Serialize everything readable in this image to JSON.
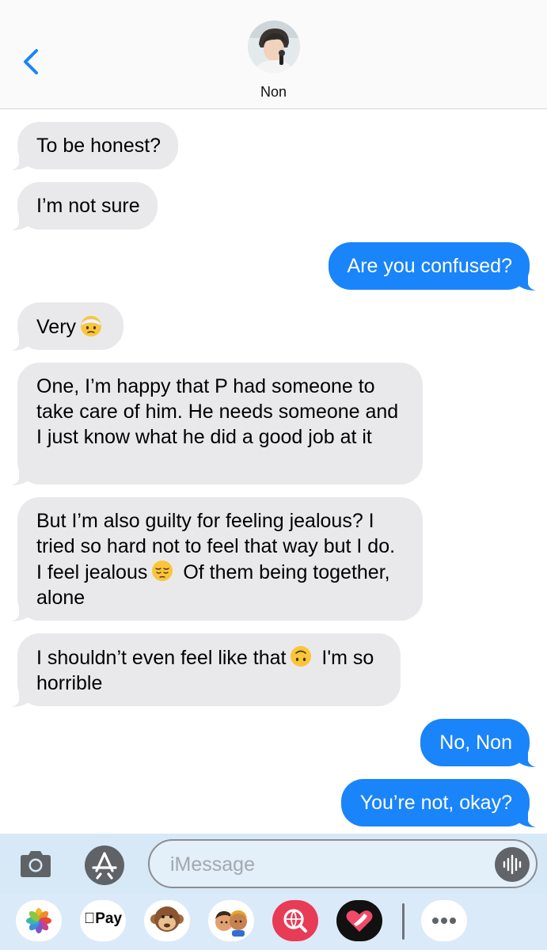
{
  "header": {
    "contact_name": "Non"
  },
  "messages": [
    {
      "side": "in",
      "text": "To be honest?"
    },
    {
      "side": "in",
      "text": "I’m not sure"
    },
    {
      "side": "out",
      "text": "Are you confused?"
    },
    {
      "side": "in",
      "text": "Very",
      "emoji": "head-bandage-emoji"
    },
    {
      "side": "in",
      "text": "One, I’m happy that P had someone to take care of him. He needs someone and I just know what he did a good job at it"
    },
    {
      "side": "in",
      "text_before": "But I’m also guilty for feeling jealous? I tried so hard not to feel that way but I do. I feel jealous",
      "emoji": "pensive-face-emoji",
      "text_after": "Of them being together, alone"
    },
    {
      "side": "in",
      "text_before": "I shouldn’t even feel like that",
      "emoji": "upside-down-face-emoji",
      "text_after": "I'm so horrible"
    },
    {
      "side": "out",
      "text": "No, Non"
    },
    {
      "side": "out",
      "text": "You’re not, okay?"
    }
  ],
  "input_bar": {
    "placeholder": "iMessage",
    "value": ""
  },
  "app_drawer": {
    "items": [
      {
        "icon": "photos-app-icon"
      },
      {
        "icon": "apple-pay-icon",
        "label": "Pay"
      },
      {
        "icon": "animoji-monkey-icon"
      },
      {
        "icon": "memoji-stickers-icon"
      },
      {
        "icon": "web-search-icon"
      },
      {
        "icon": "digital-touch-icon"
      },
      {
        "icon": "more-apps-icon"
      }
    ]
  },
  "colors": {
    "outgoing_bubble": "#1a84fa",
    "incoming_bubble": "#e9e9eb",
    "accent": "#1a84fa"
  }
}
